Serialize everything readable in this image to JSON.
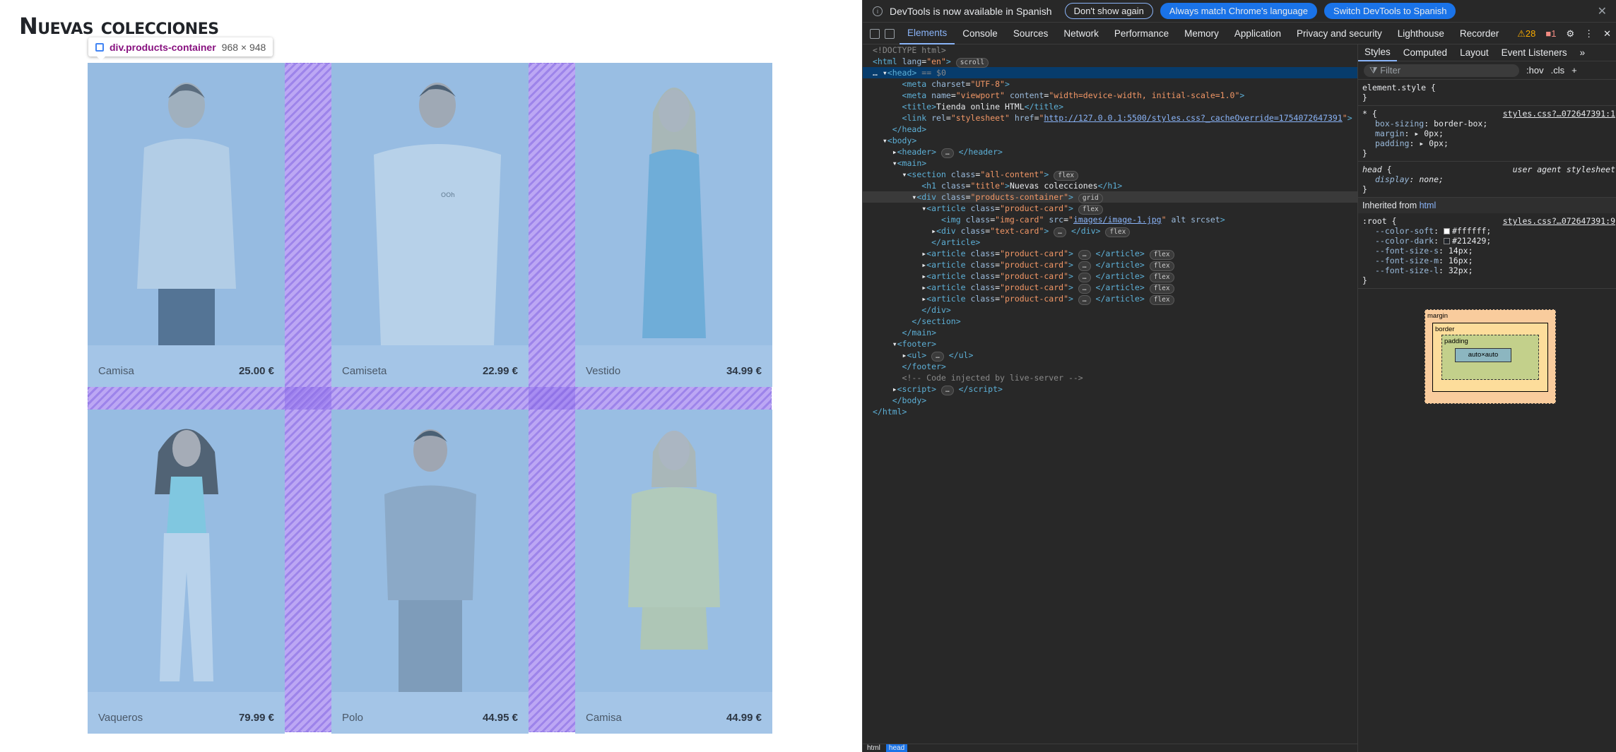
{
  "page": {
    "title": "Nuevas colecciones",
    "tooltip": {
      "selector": "div.products-container",
      "size": "968 × 948"
    },
    "products": [
      {
        "name": "Camisa",
        "price": "25.00 €",
        "figure": "man-white-shirt"
      },
      {
        "name": "Camiseta",
        "price": "22.99 €",
        "figure": "man-white-tshirt"
      },
      {
        "name": "Vestido",
        "price": "34.99 €",
        "figure": "woman-blue-dress"
      },
      {
        "name": "Vaqueros",
        "price": "79.99 €",
        "figure": "woman-white-jeans"
      },
      {
        "name": "Polo",
        "price": "44.95 €",
        "figure": "man-grey-polo"
      },
      {
        "name": "Camisa",
        "price": "44.99 €",
        "figure": "woman-yellow-shirt"
      }
    ]
  },
  "devtools": {
    "banner": {
      "message": "DevTools is now available in Spanish",
      "btn_dont_show": "Don't show again",
      "btn_match": "Always match Chrome's language",
      "btn_switch": "Switch DevTools to Spanish"
    },
    "tabs": [
      "Elements",
      "Console",
      "Sources",
      "Network",
      "Performance",
      "Memory",
      "Application",
      "Privacy and security",
      "Lighthouse",
      "Recorder"
    ],
    "warnings": "28",
    "errors": "1",
    "styles_tabs": [
      "Styles",
      "Computed",
      "Layout",
      "Event Listeners"
    ],
    "filter_placeholder": "Filter",
    "hov": ":hov",
    "cls": ".cls",
    "element_style": "element.style {",
    "universal_source": "styles.css?…072647391:1",
    "head_rule_source": "user agent stylesheet",
    "inherited_from": "Inherited from",
    "inherited_el": "html",
    "root_source": "styles.css?…072647391:9",
    "root_vars": [
      {
        "name": "--color-soft",
        "value": "#ffffff",
        "swatch": "#ffffff"
      },
      {
        "name": "--color-dark",
        "value": "#212429",
        "swatch": "#212429"
      },
      {
        "name": "--font-size-s",
        "value": "14px"
      },
      {
        "name": "--font-size-m",
        "value": "16px"
      },
      {
        "name": "--font-size-l",
        "value": "32px"
      }
    ],
    "box_model": {
      "margin": "margin",
      "border": "border",
      "padding": "padding",
      "content": "auto×auto",
      "dash": "–"
    },
    "crumbs": [
      "html",
      "head"
    ]
  }
}
